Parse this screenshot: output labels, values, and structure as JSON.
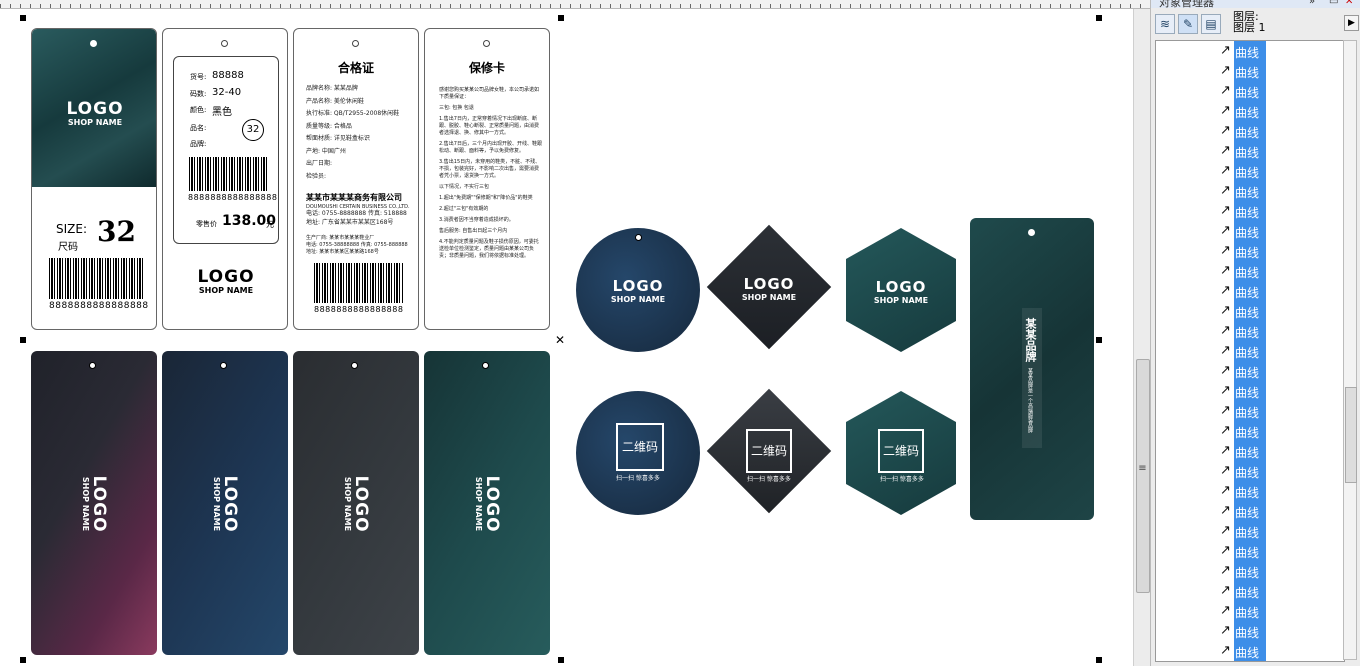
{
  "colors": {
    "teal": "#1d4a4c",
    "navy": "#1b3550",
    "charcoal": "#2d3136",
    "wine": "#6a2a4a",
    "highlight": "#3d8ee8"
  },
  "logo": {
    "main": "LOGO",
    "sub": "SHOP NAME"
  },
  "tag1": {
    "size_label": "SIZE:",
    "size_value": "32",
    "size_cn": "尺码",
    "barcode_num": "8888888888888888"
  },
  "tag2": {
    "item_label": "货号:",
    "item_value": "88888",
    "code_label": "码数:",
    "code_value": "32-40",
    "color_label": "颜色:",
    "color_value": "黑色",
    "name_label": "品名:",
    "brand_label": "品牌:",
    "circle_num": "32",
    "barcode_num": "8888888888888888",
    "price_label": "零售价",
    "price_value": "138.00",
    "price_unit": "元"
  },
  "tag3": {
    "title": "合格证",
    "rows": [
      "品牌名称: 某某品牌",
      "产品名称: 美伦休闲鞋",
      "执行标准: QB/T2955-2008休闲鞋",
      "质量等级: 合格品",
      "帮面材质: 详见鞋盒标识",
      "产地: 中国广州",
      "出厂日期:",
      "检验员:"
    ],
    "company": "某某市某某某商务有限公司",
    "company_en": "DOUMOUSHI CERTAIN BUSINESS CO.,LTD.",
    "tel": "电话: 0755-8888888  传真: 518888",
    "addr": "地址: 广东省某某市某某区168号",
    "addr2": "生产厂商: 某某市某某某鞋业厂",
    "addr3": "电话: 0755-38888888 传真: 0755-888888",
    "addr4": "地址: 某某市某某区某某路168号",
    "barcode_num": "8888888888888888"
  },
  "tag4": {
    "title": "保修卡",
    "lines": [
      "感谢您购买某某公司品牌女鞋，本公司承诺如下质量保证：",
      "三包: 包换 包退",
      "1.售出7日内，正常穿着情况下出现断底、断跟、脱胶、鞋心断裂、正常质量问题，由消费者选择退、换、修其中一方式。",
      "2.售出7日后，三个月内出现开胶、开线、鞋跟松动、断跟、面料等，予以免费修复。",
      "3.售出15日内，未穿用的鞋类，不脏、不残、不损，包装完好，不影响二次出售，需要消费者凭小票，退货换一方式。",
      "以下情况，不实行三包",
      "1.超出\"免费期\"\"保修期\"和\"降价品\"的鞋类",
      "2.超过\"三包\"有效期的",
      "3.消费者因不当穿着造成损坏的。",
      "售后服务: 自售出日起三个月内",
      "4.不能判定质量问题及鞋子损伤原因，可委托送检单位检测鉴定，质量问题由某某公司负责；非质量问题，我们将依据标准处理。"
    ]
  },
  "hang_tag": {
    "vertical_text": "某某品牌",
    "vertical_sub": "某某品牌是一个高端服装品牌"
  },
  "qr": {
    "text": "二维码",
    "caption": "扫一扫 惊喜多多"
  },
  "panel": {
    "title": "对象管理器",
    "layer_label": "图层:",
    "layer_name": "图层 1",
    "items": [
      "曲线",
      "曲线",
      "曲线",
      "曲线",
      "曲线",
      "曲线",
      "曲线",
      "曲线",
      "曲线",
      "曲线",
      "曲线",
      "曲线",
      "曲线",
      "曲线",
      "曲线",
      "曲线",
      "曲线",
      "曲线",
      "曲线",
      "曲线",
      "曲线",
      "曲线",
      "曲线",
      "曲线",
      "曲线",
      "曲线",
      "曲线",
      "曲线",
      "曲线",
      "曲线",
      "曲线"
    ]
  }
}
